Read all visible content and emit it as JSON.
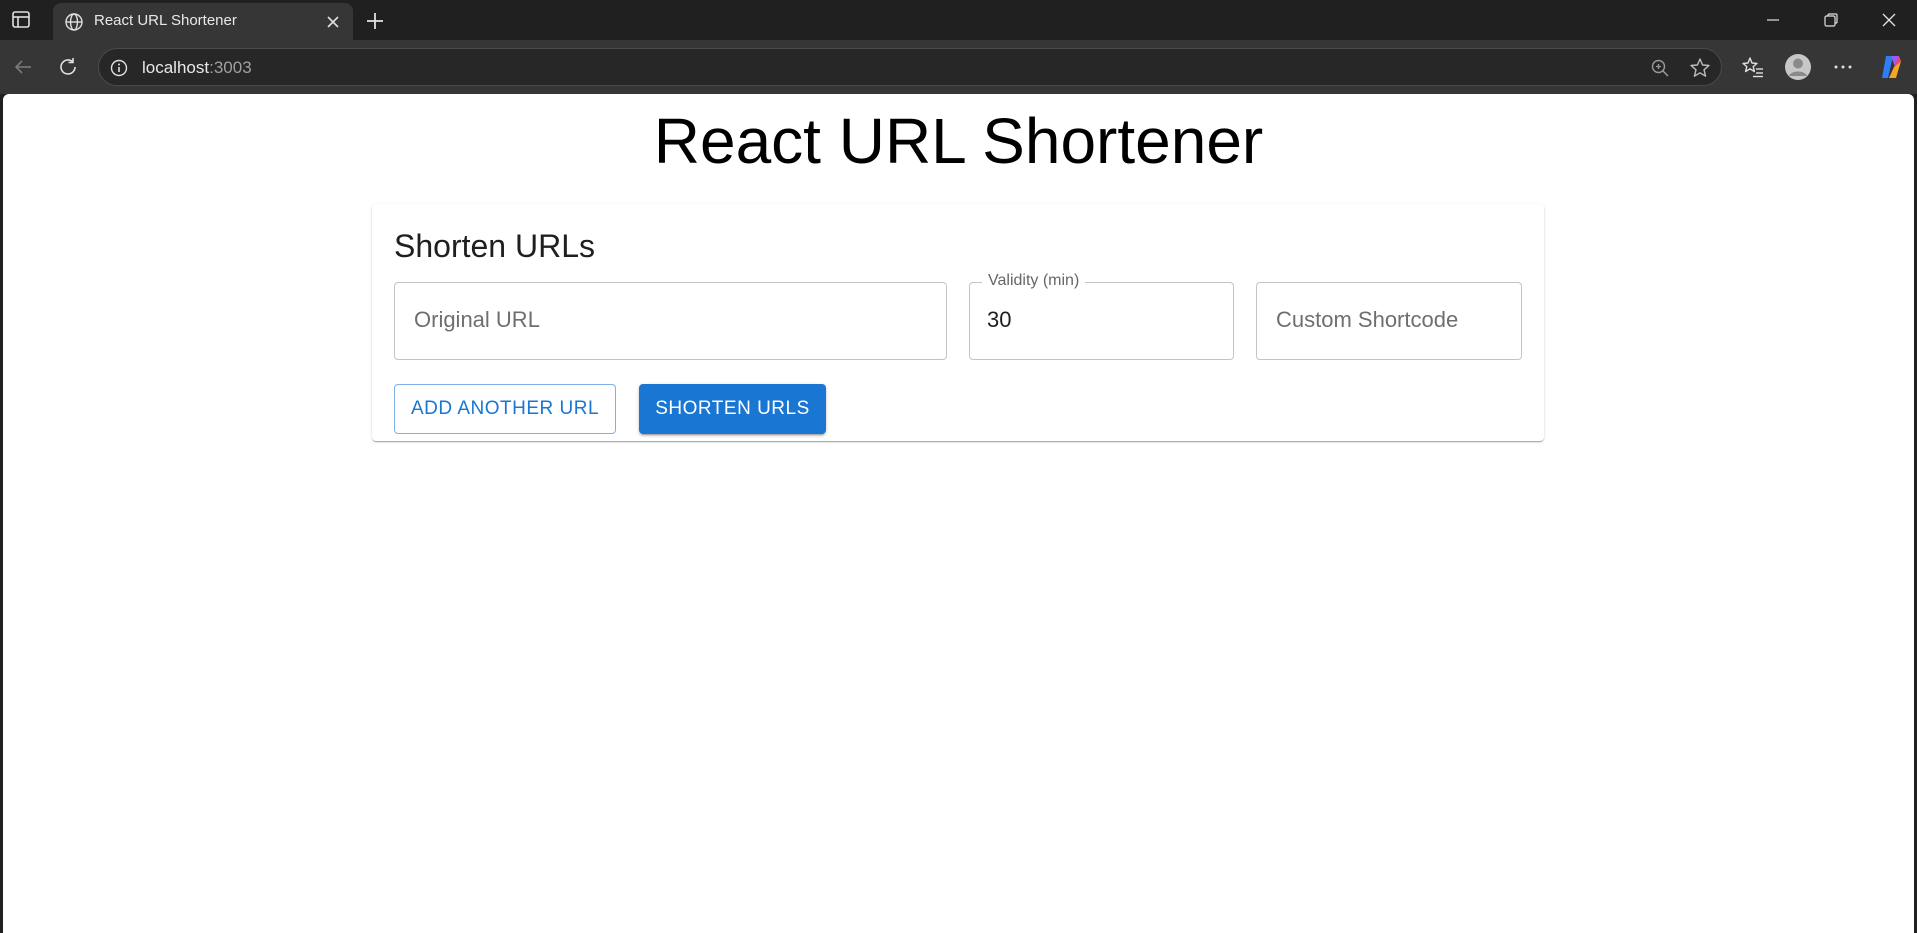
{
  "browser": {
    "tab_title": "React URL Shortener",
    "url_host": "localhost",
    "url_port": ":3003"
  },
  "page": {
    "title": "React URL Shortener"
  },
  "form": {
    "heading": "Shorten URLs",
    "original_url_placeholder": "Original URL",
    "validity_label": "Validity (min)",
    "validity_value": "30",
    "shortcode_placeholder": "Custom Shortcode",
    "add_button": "ADD ANOTHER URL",
    "submit_button": "SHORTEN URLS"
  },
  "colors": {
    "accent": "#1976d2"
  }
}
